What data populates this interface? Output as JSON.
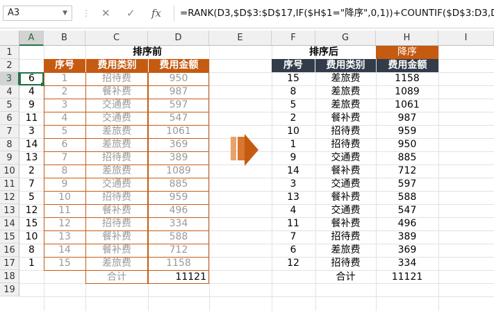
{
  "formula_bar": {
    "name_box": "A3",
    "fx_label": "fx",
    "formula": "=RANK(D3,$D$3:$D$17,IF($H$1=\"降序\",0,1))+COUNTIF($D$3:D3,D3)-1"
  },
  "columns": [
    "A",
    "B",
    "C",
    "D",
    "E",
    "F",
    "G",
    "H",
    "I"
  ],
  "rows": [
    "1",
    "2",
    "3",
    "4",
    "5",
    "6",
    "7",
    "8",
    "9",
    "10",
    "11",
    "12",
    "13",
    "14",
    "15",
    "16",
    "17",
    "18",
    "19"
  ],
  "left_table": {
    "title": "排序前",
    "headers": [
      "序号",
      "费用类别",
      "费用金额"
    ],
    "rank": [
      "6",
      "4",
      "9",
      "11",
      "3",
      "14",
      "13",
      "2",
      "7",
      "5",
      "12",
      "15",
      "10",
      "8",
      "1"
    ],
    "rows": [
      [
        "1",
        "招待费",
        "950"
      ],
      [
        "2",
        "餐补费",
        "987"
      ],
      [
        "3",
        "交通费",
        "597"
      ],
      [
        "4",
        "交通费",
        "547"
      ],
      [
        "5",
        "差旅费",
        "1061"
      ],
      [
        "6",
        "差旅费",
        "369"
      ],
      [
        "7",
        "招待费",
        "389"
      ],
      [
        "8",
        "差旅费",
        "1089"
      ],
      [
        "9",
        "交通费",
        "885"
      ],
      [
        "10",
        "招待费",
        "959"
      ],
      [
        "11",
        "餐补费",
        "496"
      ],
      [
        "12",
        "招待费",
        "334"
      ],
      [
        "13",
        "餐补费",
        "588"
      ],
      [
        "14",
        "餐补费",
        "712"
      ],
      [
        "15",
        "差旅费",
        "1158"
      ]
    ],
    "total_label": "合计",
    "total_value": "11121"
  },
  "right_table": {
    "title": "排序后",
    "order_option": "降序",
    "headers": [
      "序号",
      "费用类别",
      "费用金额"
    ],
    "rows": [
      [
        "15",
        "差旅费",
        "1158"
      ],
      [
        "8",
        "差旅费",
        "1089"
      ],
      [
        "5",
        "差旅费",
        "1061"
      ],
      [
        "2",
        "餐补费",
        "987"
      ],
      [
        "10",
        "招待费",
        "959"
      ],
      [
        "1",
        "招待费",
        "950"
      ],
      [
        "9",
        "交通费",
        "885"
      ],
      [
        "14",
        "餐补费",
        "712"
      ],
      [
        "3",
        "交通费",
        "597"
      ],
      [
        "13",
        "餐补费",
        "588"
      ],
      [
        "4",
        "交通费",
        "547"
      ],
      [
        "11",
        "餐补费",
        "496"
      ],
      [
        "7",
        "招待费",
        "389"
      ],
      [
        "6",
        "差旅费",
        "369"
      ],
      [
        "12",
        "招待费",
        "334"
      ]
    ],
    "total_label": "合计",
    "total_value": "11121"
  },
  "colors": {
    "accent_orange": "#c55a11",
    "dark_header": "#323c4a",
    "selection_green": "#217346"
  },
  "icons": [
    "dropdown-icon",
    "cancel-icon",
    "confirm-icon",
    "fx-icon",
    "right-arrow-icon"
  ]
}
